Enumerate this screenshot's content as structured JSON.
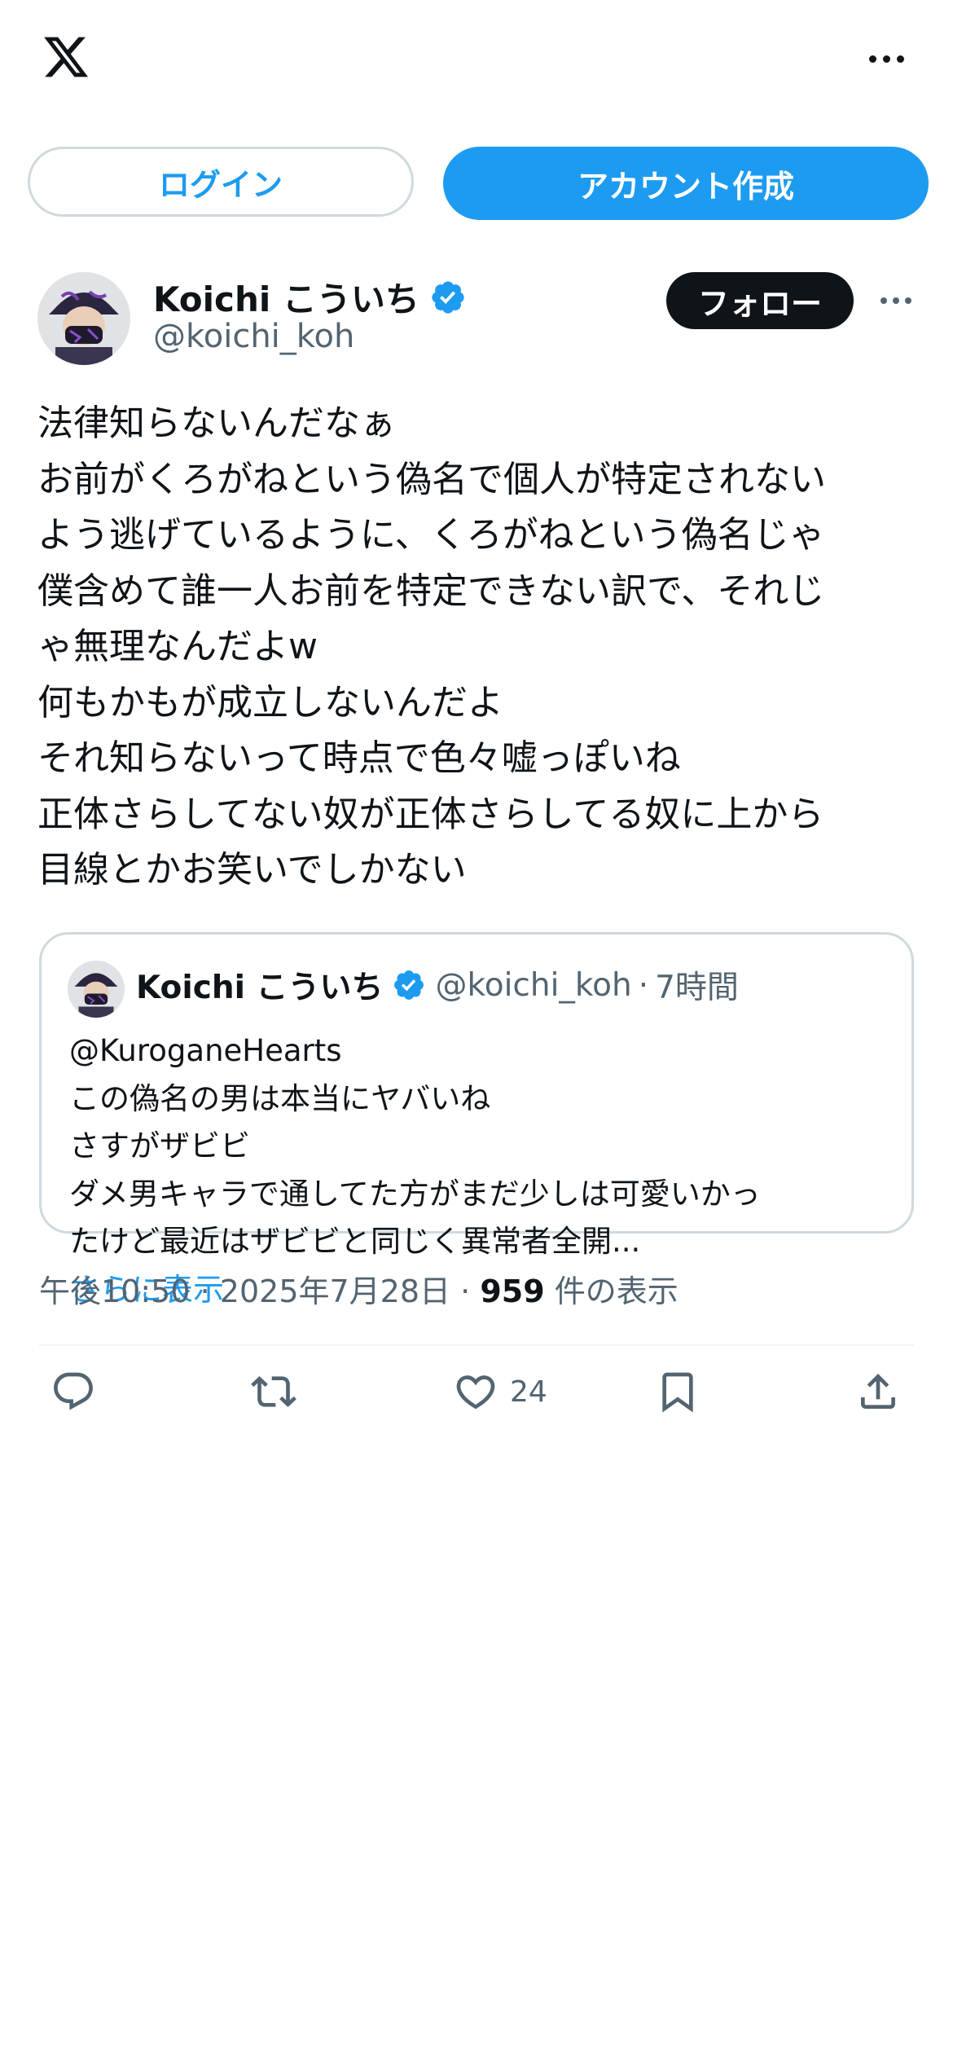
{
  "header": {
    "logo_icon": "x-logo-icon",
    "more_icon": "more-horizontal-icon"
  },
  "auth": {
    "login_label": "ログイン",
    "signup_label": "アカウント作成"
  },
  "tweet": {
    "author_name": "Koichi こういち",
    "author_handle": "@koichi_koh",
    "verified": true,
    "follow_label": "フォロー",
    "text_lines": [
      "法律知らないんだなぁ",
      "お前がくろがねという偽名で個人が特定されない",
      "よう逃げているように、くろがねという偽名じゃ",
      "僕含めて誰一人お前を特定できない訳で、それじ",
      "ゃ無理なんだよw",
      "何もかもが成立しないんだよ",
      "それ知らないって時点で色々嘘っぽいね",
      "正体さらしてない奴が正体さらしてる奴に上から",
      "目線とかお笑いでしかない"
    ],
    "quote": {
      "author_name": "Koichi こういち",
      "author_handle": "@koichi_koh",
      "separator": "·",
      "time": "7時間",
      "text_lines": [
        "@KuroganeHearts",
        "この偽名の男は本当にヤバいね",
        "さすがザビビ",
        "ダメ男キャラで通してた方がまだ少しは可愛いかっ",
        "たけど最近はザビビと同じく異常者全開..."
      ],
      "show_more": "さらに表示"
    },
    "time": "午後10:50",
    "separator": "·",
    "date": "2025年7月28日",
    "views_count": "959",
    "views_label": "件の表示",
    "actions": {
      "reply_icon": "reply-icon",
      "retweet_icon": "retweet-icon",
      "like_icon": "heart-icon",
      "like_count": "24",
      "bookmark_icon": "bookmark-icon",
      "share_icon": "share-icon"
    }
  },
  "colors": {
    "accent": "#1d9bf0",
    "text": "#0f1419",
    "secondary": "#536471",
    "border": "#cfd9de"
  }
}
